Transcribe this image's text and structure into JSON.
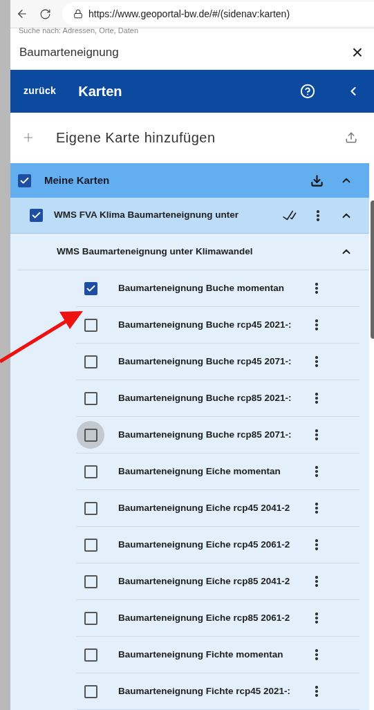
{
  "browser": {
    "url": "https://www.geoportal-bw.de/#/(sidenav:karten)"
  },
  "search": {
    "placeholder": "Suche nach: Adressen, Orte, Daten"
  },
  "dialog": {
    "title": "Baumarteneignung",
    "close": "×"
  },
  "header": {
    "back_label": "zurück",
    "title": "Karten"
  },
  "add_map": {
    "label": "Eigene Karte hinzufügen"
  },
  "group": {
    "label": "Meine Karten",
    "checked": true,
    "expanded": true
  },
  "service": {
    "label": "WMS FVA Klima Baumarteneignung unter",
    "checked": true,
    "expanded": true
  },
  "layer_group": {
    "label": "WMS Baumarteneignung unter Klimawandel",
    "expanded": true
  },
  "layers": [
    {
      "label": "Baumarteneignung Buche momentan",
      "checked": true,
      "hovered": false
    },
    {
      "label": "Baumarteneignung Buche rcp45 2021-:",
      "checked": false,
      "hovered": false
    },
    {
      "label": "Baumarteneignung Buche rcp45 2071-:",
      "checked": false,
      "hovered": false
    },
    {
      "label": "Baumarteneignung Buche rcp85 2021-:",
      "checked": false,
      "hovered": false
    },
    {
      "label": "Baumarteneignung Buche rcp85 2071-:",
      "checked": false,
      "hovered": true
    },
    {
      "label": "Baumarteneignung Eiche momentan",
      "checked": false,
      "hovered": false
    },
    {
      "label": "Baumarteneignung Eiche rcp45 2041-2",
      "checked": false,
      "hovered": false
    },
    {
      "label": "Baumarteneignung Eiche rcp45 2061-2",
      "checked": false,
      "hovered": false
    },
    {
      "label": "Baumarteneignung Eiche rcp85 2041-2",
      "checked": false,
      "hovered": false
    },
    {
      "label": "Baumarteneignung Eiche rcp85 2061-2",
      "checked": false,
      "hovered": false
    },
    {
      "label": "Baumarteneignung Fichte momentan",
      "checked": false,
      "hovered": false
    },
    {
      "label": "Baumarteneignung Fichte rcp45 2021-:",
      "checked": false,
      "hovered": false
    }
  ]
}
